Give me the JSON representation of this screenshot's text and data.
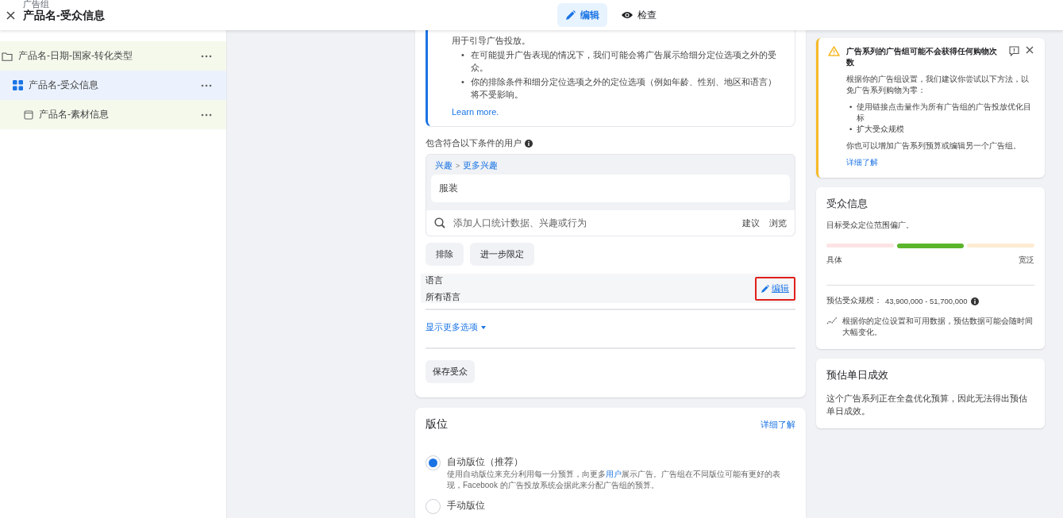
{
  "header": {
    "section_label": "广告组",
    "title": "产品名-受众信息",
    "tabs": [
      {
        "label": "编辑",
        "kind": "edit",
        "selected": true
      },
      {
        "label": "检查",
        "kind": "preview",
        "selected": false
      }
    ]
  },
  "sidebar": {
    "tree": [
      {
        "label": "产品名-日期-国家-转化类型",
        "kind": "campaign",
        "selected": false,
        "children": [
          {
            "label": "产品名-受众信息",
            "kind": "adset",
            "selected": true,
            "children": [
              {
                "label": "产品名-素材信息",
                "kind": "ad",
                "selected": false
              }
            ]
          }
        ]
      }
    ]
  },
  "audience_card": {
    "notice": {
      "intro": "用于引导广告投放。",
      "bullet_marker": "•",
      "bullets": [
        "在可能提升广告表现的情况下，我们可能会将广告展示给细分定位选项之外的受众。",
        "你的排除条件和细分定位选项之外的定位选项（例如年龄、性别、地区和语言）将不受影响。"
      ],
      "link": "Learn more."
    },
    "include_label": "包含符合以下条件的用户",
    "breadcrumb": [
      "兴趣",
      "更多兴趣"
    ],
    "breadcrumb_separator": ">",
    "interests": [
      "服装"
    ],
    "search": {
      "placeholder": "添加人口统计数据、兴趣或行为",
      "actions": [
        "建议",
        "浏览"
      ]
    },
    "buttons": [
      "排除",
      "进一步限定"
    ],
    "language": {
      "label": "语言",
      "value": "所有语言",
      "edit": "编辑",
      "highlighted": true
    },
    "more_options": "显示更多选项",
    "save": "保存受众"
  },
  "placements_card": {
    "title": "版位",
    "link": "详细了解",
    "options": [
      {
        "label": "自动版位（推荐）",
        "selected": true,
        "description": "使用自动版位来充分利用每一分预算，向更多",
        "description_link": "用户",
        "description_end": "展示广告。广告组在不同版位可能有更好的表现，Facebook 的广告投放系统会据此来分配广告组的预算。"
      },
      {
        "label": "手动版位",
        "selected": false
      }
    ]
  },
  "alert": {
    "title": "广告系列的广告组可能不会获得任何购物次数",
    "body": "根据你的广告组设置，我们建议你尝试以下方法，以免广告系列购物为零：",
    "bullet_marker": "•",
    "bullets": [
      "使用链接点击量作为所有广告组的广告投放优化目标",
      "扩大受众规模"
    ],
    "footer": "你也可以增加广告系列预算或编辑另一个广告组。",
    "link": "详细了解"
  },
  "audience_info": {
    "title": "受众信息",
    "summary": "目标受众定位范围偏广。",
    "segments": [
      {
        "color": "#fce4e4",
        "selected": false
      },
      {
        "color": "#5bb52b",
        "selected": true
      },
      {
        "color": "#fdebd2",
        "selected": false
      }
    ],
    "scale_labels": [
      "具体",
      "宽泛"
    ],
    "size_label": "预估受众规模：",
    "size_value": "43,900,000 - 51,700,000",
    "note": "根据你的定位设置和可用数据，预估数据可能会随时间大幅变化。"
  },
  "daily_results": {
    "title": "预估单日成效",
    "body": "这个广告系列正在全盘优化预算，因此无法得出预估单日成效。"
  }
}
